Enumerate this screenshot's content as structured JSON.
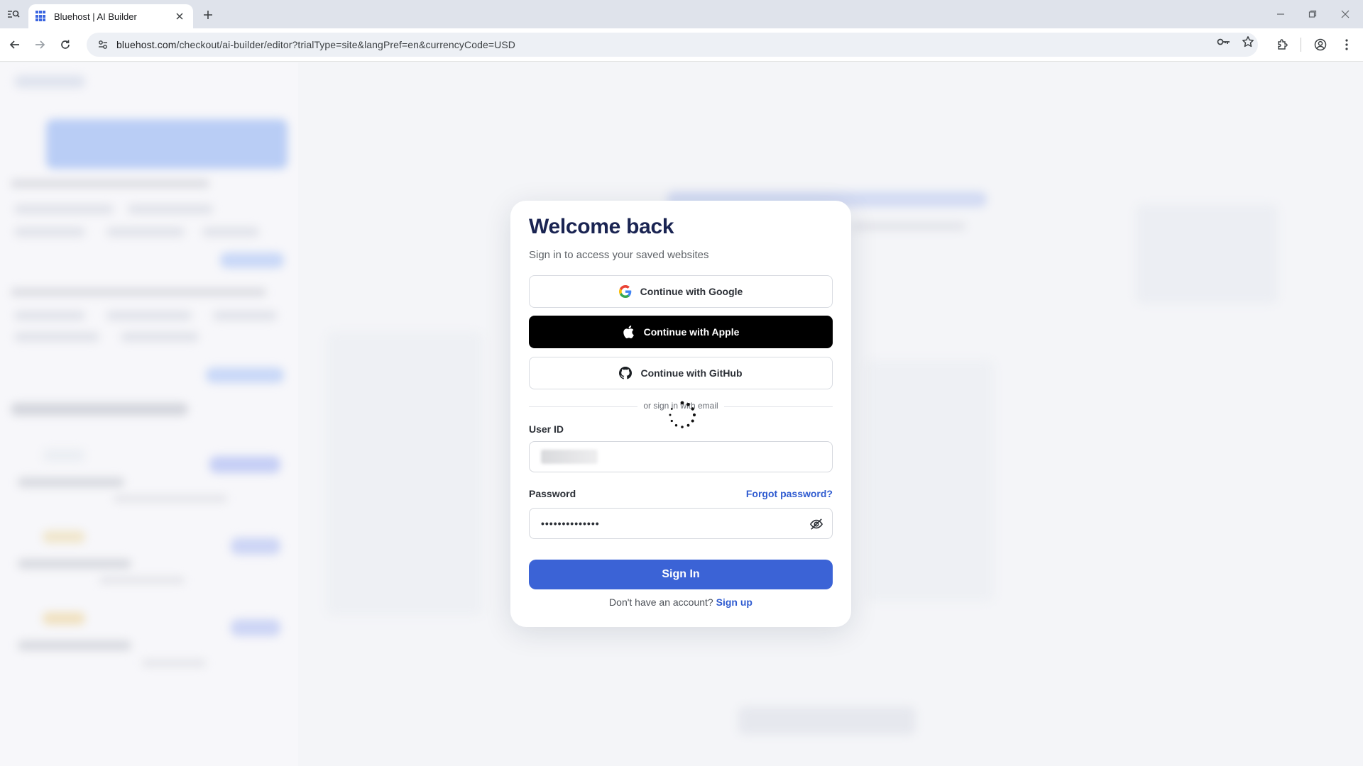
{
  "browser": {
    "tab_title": "Bluehost | AI Builder",
    "url_host": "bluehost.com",
    "url_path": "/checkout/ai-builder/editor?trialType=site&langPref=en&currencyCode=USD"
  },
  "modal": {
    "title": "Welcome back",
    "subtitle": "Sign in to access your saved websites",
    "google_label": "Continue with Google",
    "apple_label": "Continue with Apple",
    "github_label": "Continue with GitHub",
    "divider_text": "or sign in with email",
    "userid_label": "User ID",
    "password_label": "Password",
    "forgot_label": "Forgot password?",
    "password_value": "••••••••••••••",
    "signin_label": "Sign In",
    "no_account_text": "Don't have an account?",
    "signup_label": "Sign up"
  },
  "colors": {
    "brand_blue": "#3b63d6",
    "title_navy": "#1a2452",
    "link_blue": "#2f5bd0"
  },
  "icons": {
    "google": "google-icon",
    "apple": "apple-icon",
    "github": "github-icon",
    "eye": "eye-slash-icon",
    "loading": "spinner-icon"
  }
}
